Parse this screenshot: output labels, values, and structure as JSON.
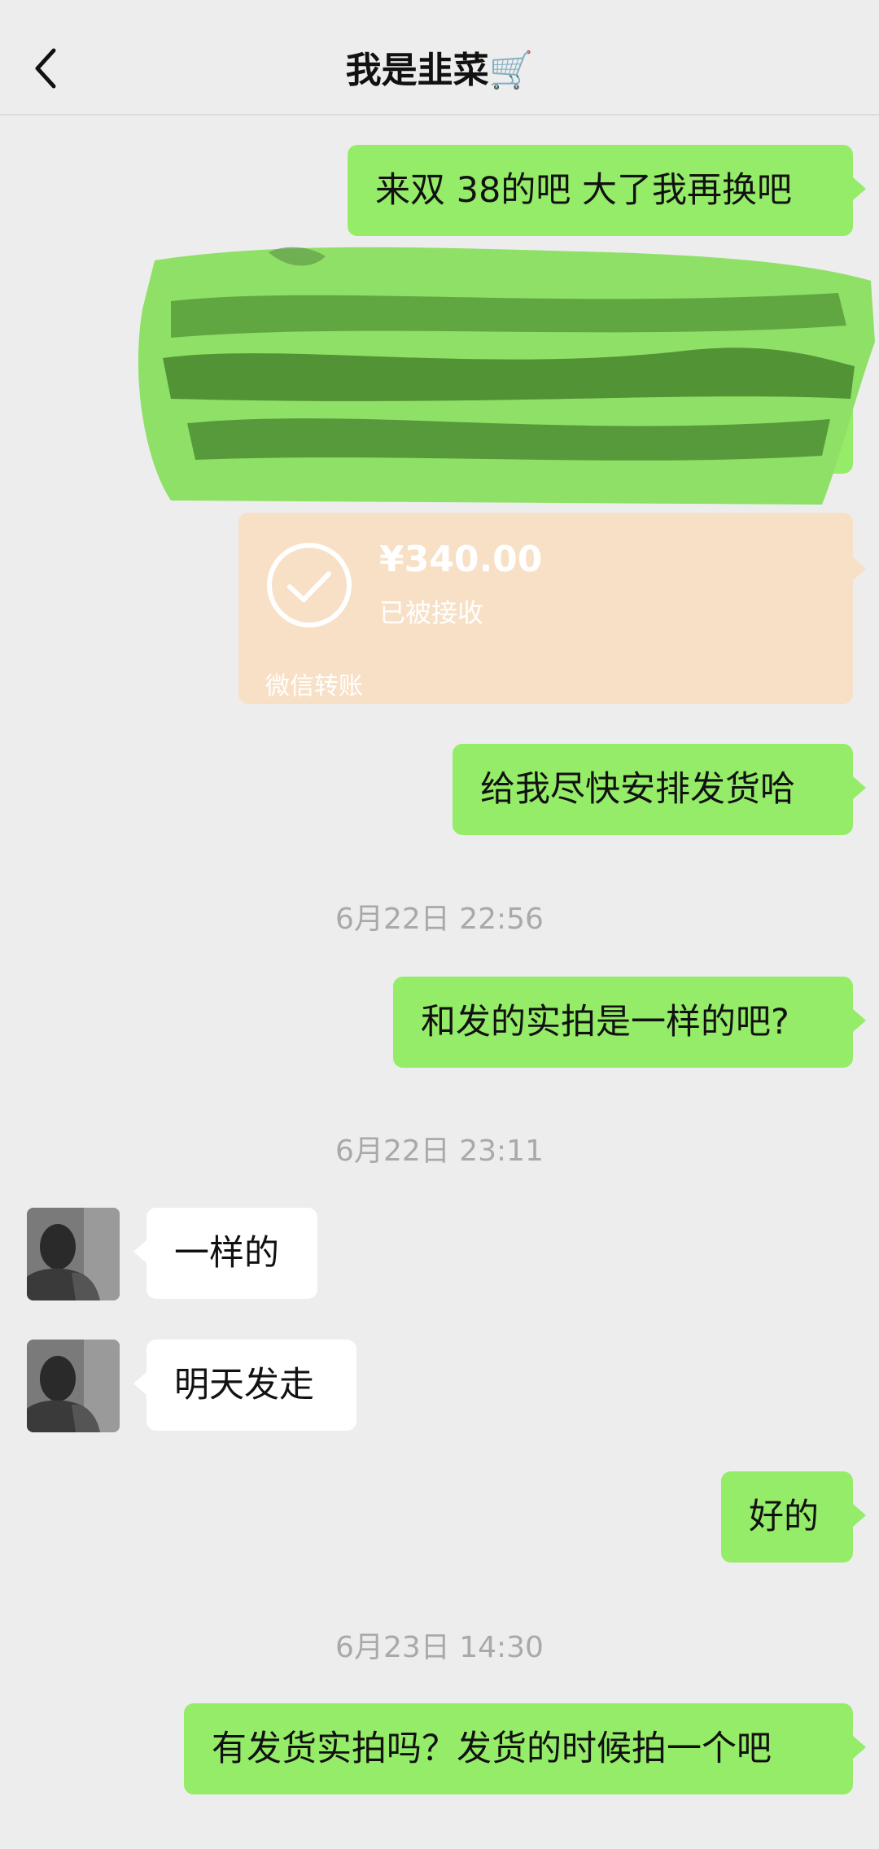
{
  "header": {
    "back_icon": "chevron-left-icon",
    "title": "我是韭菜🛒"
  },
  "messages": {
    "m1": "来双 38的吧 大了我再换吧",
    "m2": "给我尽快安排发货哈",
    "m3": "和发的实拍是一样的吧?",
    "m4": "一样的",
    "m5": "明天发走",
    "m6": "好的",
    "m7": "有发货实拍吗？发货的时候拍一个吧"
  },
  "transfer": {
    "amount": "¥340.00",
    "status": "已被接收",
    "label": "微信转账",
    "icon": "check-circle-icon",
    "color": "#f8e0c6"
  },
  "timestamps": {
    "t1": "6月22日 22:56",
    "t2": "6月22日 23:11",
    "t3": "6月23日 14:30"
  },
  "colors": {
    "my_bubble": "#95ec69",
    "other_bubble": "#ffffff",
    "background": "#ededed"
  }
}
